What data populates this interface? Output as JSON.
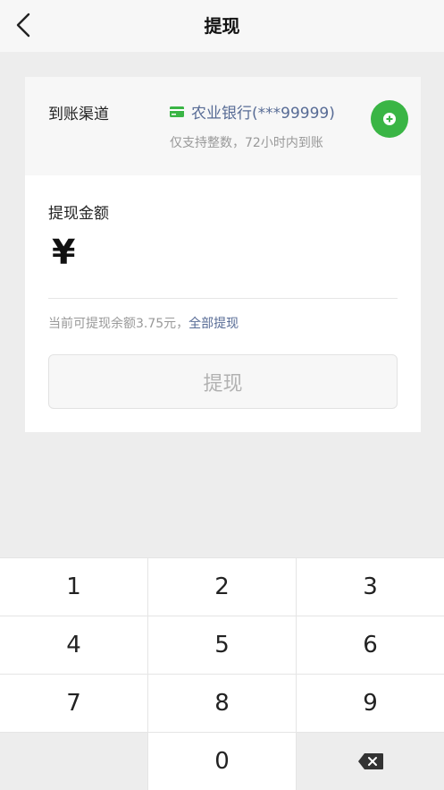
{
  "header": {
    "title": "提现"
  },
  "channel": {
    "label": "到账渠道",
    "bank_name": "农业银行(***99999)",
    "note": "仅支持整数，72小时内到账"
  },
  "amount": {
    "label": "提现金额",
    "currency_symbol": "¥",
    "value": "",
    "balance_text": "当前可提现余额3.75元，",
    "withdraw_all_label": "全部提现",
    "submit_label": "提现"
  },
  "keypad": {
    "keys": [
      "1",
      "2",
      "3",
      "4",
      "5",
      "6",
      "7",
      "8",
      "9",
      "0"
    ]
  },
  "colors": {
    "accent_green": "#3ab545",
    "link_blue": "#576b95"
  }
}
